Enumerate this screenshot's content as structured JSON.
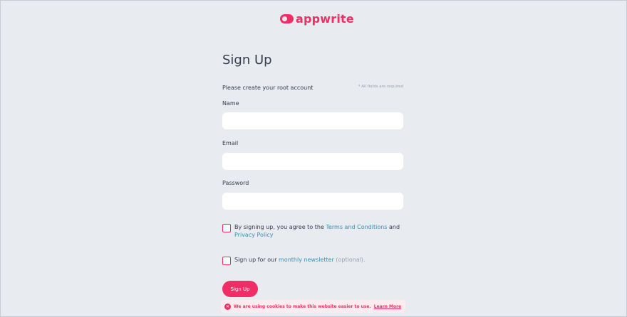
{
  "brand": {
    "name": "appwrite",
    "accent_color": "#f02e65",
    "logo_icon": "appwrite-logo-icon"
  },
  "form": {
    "title": "Sign Up",
    "subtitle": "Please create your root account",
    "required_note": "* All fields are required",
    "fields": {
      "name": {
        "label": "Name",
        "value": "",
        "placeholder": ""
      },
      "email": {
        "label": "Email",
        "value": "",
        "placeholder": ""
      },
      "password": {
        "label": "Password",
        "value": "",
        "placeholder": ""
      }
    },
    "terms": {
      "prefix": "By signing up, you agree to the",
      "terms_link": "Terms and Conditions",
      "and": "and",
      "privacy_link": "Privacy Policy",
      "checked": false
    },
    "newsletter": {
      "prefix": "Sign up for our",
      "link": "monthly newsletter",
      "suffix": "(optional).",
      "checked": false
    },
    "submit_label": "Sign Up"
  },
  "cookie_banner": {
    "icon": "close-icon",
    "message": "We are using cookies to make this website easier to use.",
    "link": "Learn More"
  }
}
